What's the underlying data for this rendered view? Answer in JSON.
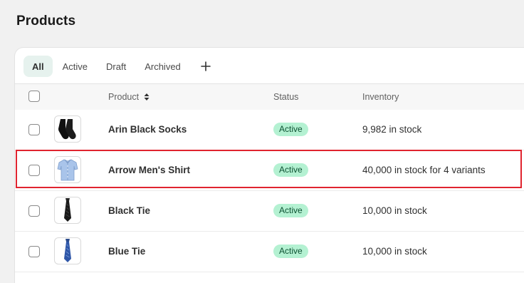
{
  "page": {
    "title": "Products"
  },
  "tabs": [
    {
      "label": "All",
      "selected": true
    },
    {
      "label": "Active",
      "selected": false
    },
    {
      "label": "Draft",
      "selected": false
    },
    {
      "label": "Archived",
      "selected": false
    }
  ],
  "table": {
    "columns": {
      "product": "Product",
      "status": "Status",
      "inventory": "Inventory"
    },
    "rows": [
      {
        "name": "Arin Black Socks",
        "status": "Active",
        "inventory": "9,982 in stock",
        "thumbnail": "black-socks-image",
        "highlighted": false
      },
      {
        "name": "Arrow Men's Shirt",
        "status": "Active",
        "inventory": "40,000 in stock for 4 variants",
        "thumbnail": "blue-shirt-image",
        "highlighted": true
      },
      {
        "name": "Black Tie",
        "status": "Active",
        "inventory": "10,000 in stock",
        "thumbnail": "black-tie-image",
        "highlighted": false
      },
      {
        "name": "Blue Tie",
        "status": "Active",
        "inventory": "10,000 in stock",
        "thumbnail": "blue-tie-image",
        "highlighted": false
      }
    ]
  },
  "colors": {
    "status_active_bg": "#b4f1d2",
    "status_active_text": "#0c5132",
    "selected_tab_bg": "#e6f2ee",
    "highlight_border": "#e0242f"
  },
  "icons": {
    "add_view": "plus-icon",
    "sort": "sort-arrows-icon"
  }
}
